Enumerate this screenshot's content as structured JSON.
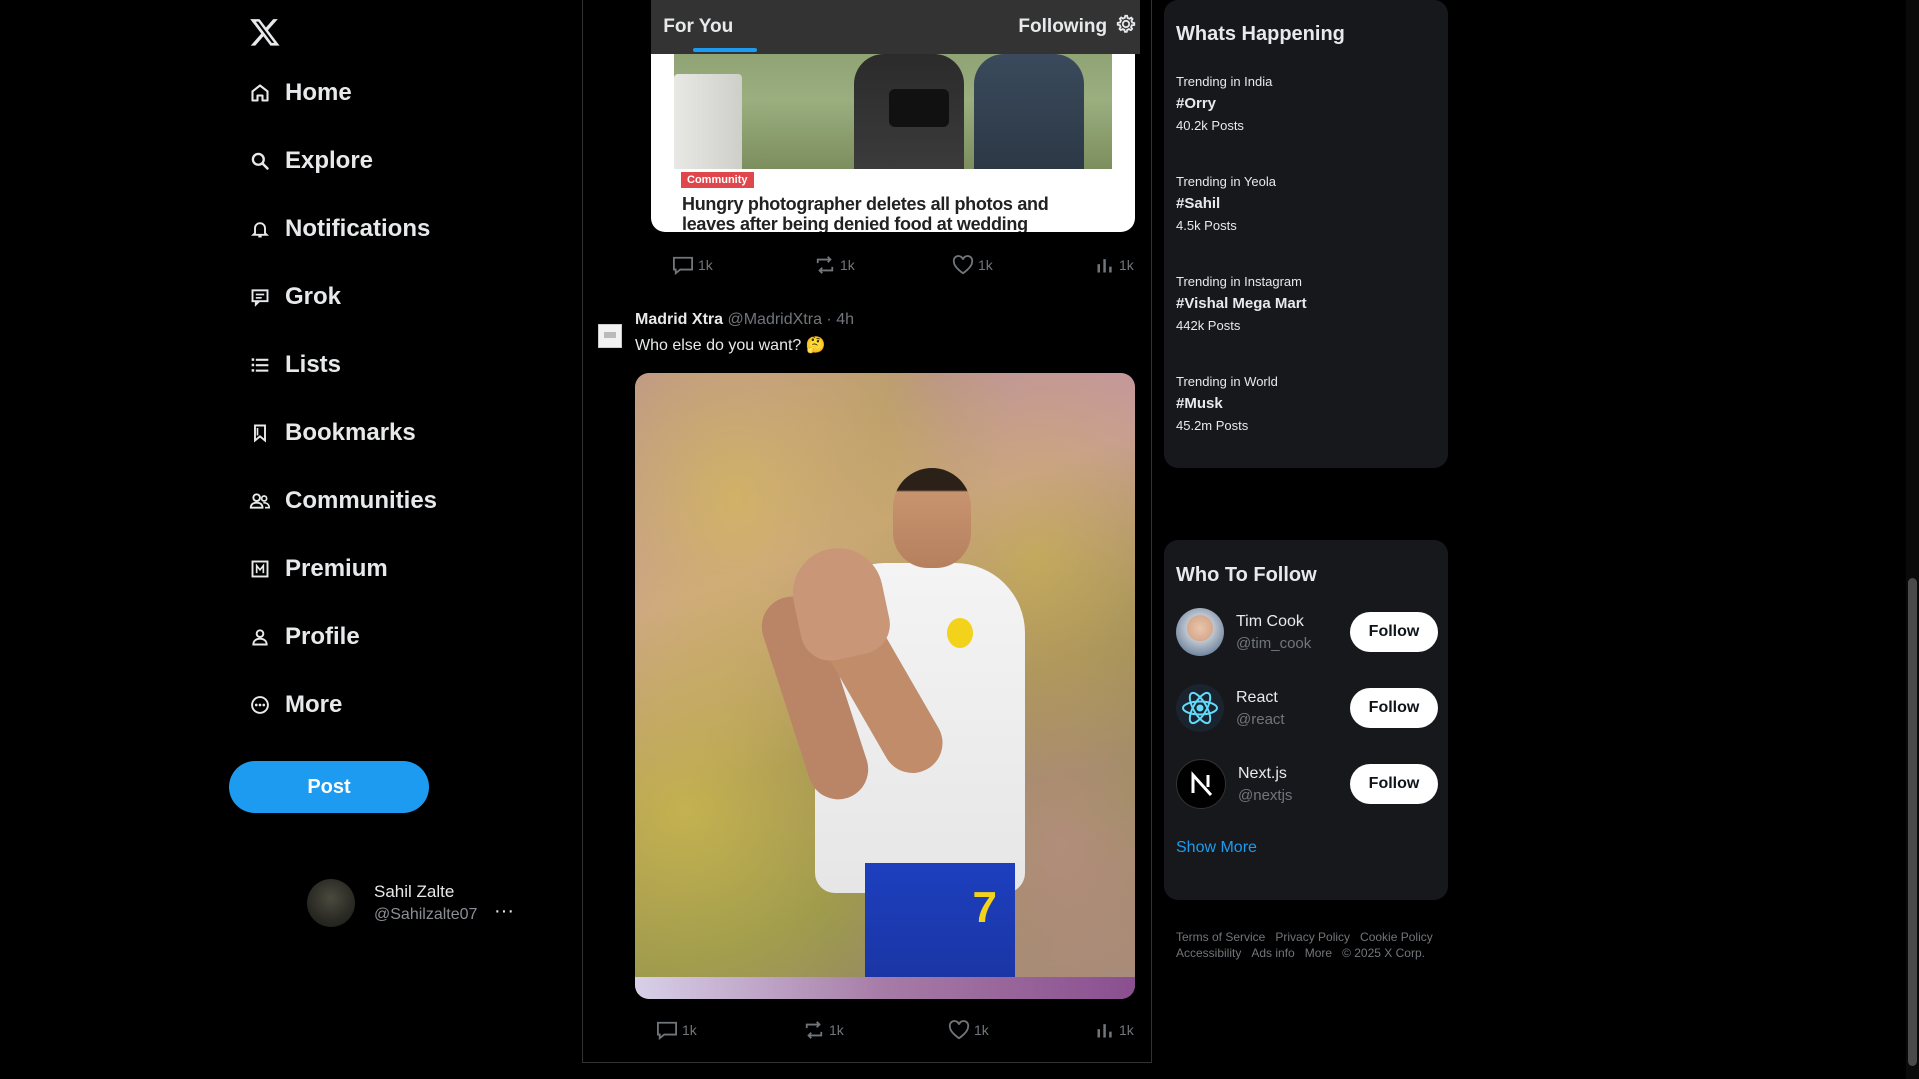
{
  "app": {
    "logo": "x-logo-icon"
  },
  "nav": {
    "items": [
      {
        "label": "Home",
        "icon": "home-icon"
      },
      {
        "label": "Explore",
        "icon": "search-icon"
      },
      {
        "label": "Notifications",
        "icon": "bell-icon"
      },
      {
        "label": "Grok",
        "icon": "grok-icon"
      },
      {
        "label": "Lists",
        "icon": "list-icon"
      },
      {
        "label": "Bookmarks",
        "icon": "bookmark-icon"
      },
      {
        "label": "Communities",
        "icon": "people-icon"
      },
      {
        "label": "Premium",
        "icon": "premium-icon"
      },
      {
        "label": "Profile",
        "icon": "person-icon"
      },
      {
        "label": "More",
        "icon": "more-circle-icon"
      }
    ],
    "post_label": "Post"
  },
  "account": {
    "name": "Sahil Zalte",
    "handle": "@Sahilzalte07",
    "menu": "···"
  },
  "tabs": {
    "for_you": "For You",
    "following": "Following",
    "active": "For You"
  },
  "card": {
    "badge": "Community",
    "headline": "Hungry photographer deletes all photos and leaves after being denied food at wedding",
    "stats": {
      "replies": "1k",
      "reposts": "1k",
      "likes": "1k",
      "views": "1k"
    }
  },
  "tweet": {
    "author": "Madrid Xtra",
    "handle": "@MadridXtra",
    "time": "4h",
    "separator": "·",
    "text": "Who else do you want? 🤔",
    "stats": {
      "replies": "1k",
      "reposts": "1k",
      "likes": "1k",
      "views": "1k"
    }
  },
  "trends": {
    "title": "Whats Happening",
    "items": [
      {
        "location": "Trending in India",
        "tag": "#Orry",
        "count": "40.2k Posts"
      },
      {
        "location": "Trending in Yeola",
        "tag": "#Sahil",
        "count": "4.5k Posts"
      },
      {
        "location": "Trending in Instagram",
        "tag": "#Vishal Mega Mart",
        "count": "442k Posts"
      },
      {
        "location": "Trending in World",
        "tag": "#Musk",
        "count": "45.2m Posts"
      }
    ]
  },
  "who_to_follow": {
    "title": "Who To Follow",
    "follow_label": "Follow",
    "show_more": "Show More",
    "users": [
      {
        "name": "Tim Cook",
        "handle": "@tim_cook"
      },
      {
        "name": "React",
        "handle": "@react"
      },
      {
        "name": "Next.js",
        "handle": "@nextjs"
      }
    ]
  },
  "footer": {
    "links": [
      "Terms of Service",
      "Privacy Policy",
      "Cookie Policy",
      "Accessibility",
      "Ads info",
      "More",
      "© 2025 X Corp."
    ]
  },
  "colors": {
    "accent": "#1d9bf0",
    "background": "#000000",
    "panel": "#16181c",
    "muted": "#71767b"
  }
}
